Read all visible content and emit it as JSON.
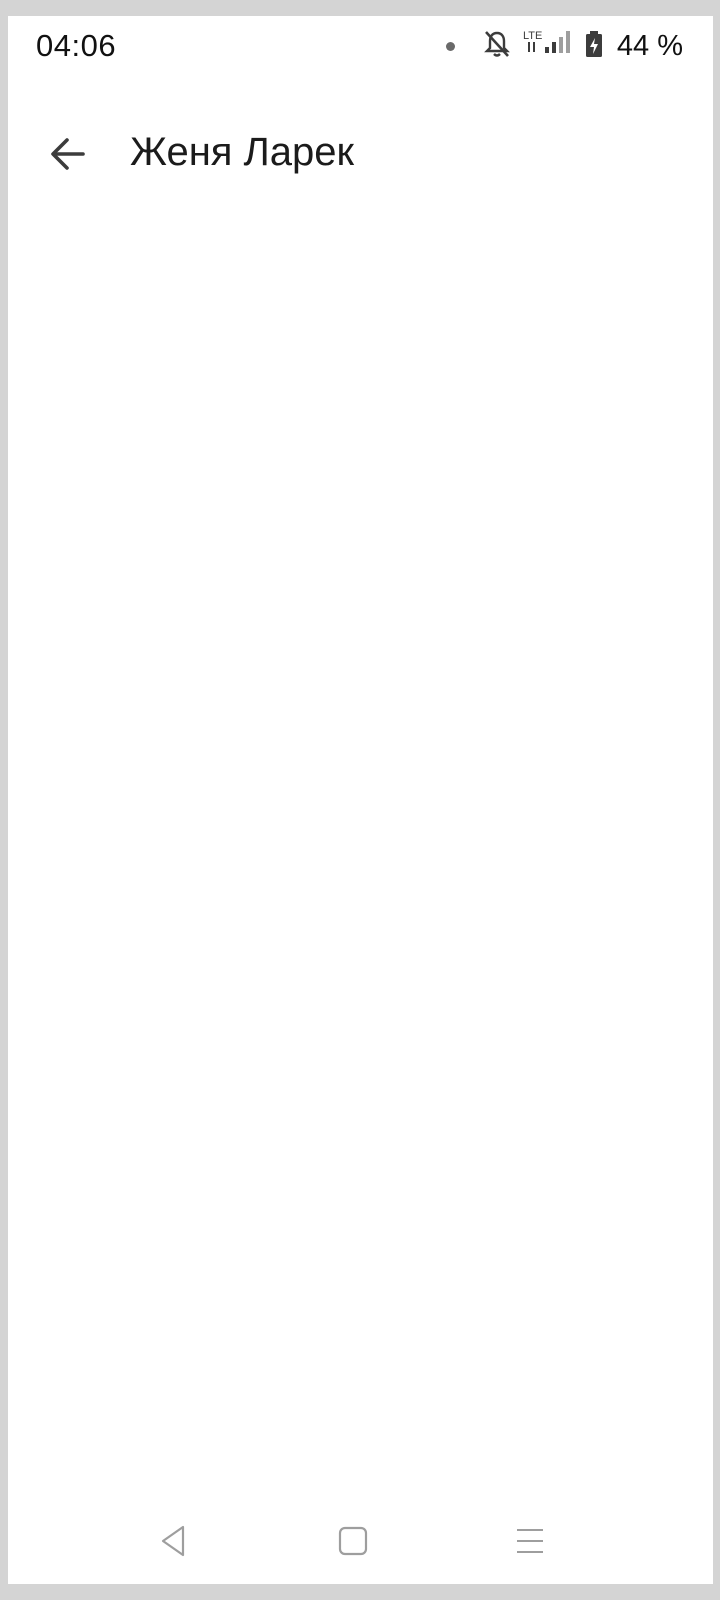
{
  "status_bar": {
    "time": "04:06",
    "battery_text": "44 %",
    "network_label": "LTE",
    "icons": [
      "notification-dot-icon",
      "bell-off-icon",
      "lte-signal-icon",
      "battery-charging-icon"
    ]
  },
  "app_bar": {
    "title": "Женя Ларек",
    "back_icon": "arrow-left-icon"
  },
  "nav_bar": {
    "icons": [
      "nav-back-icon",
      "nav-home-icon",
      "nav-menu-icon"
    ]
  },
  "colors": {
    "background": "#ffffff",
    "frame": "#d4d4d4",
    "text": "#1b1b1b",
    "icon": "#3c3c3c",
    "nav_icon": "#9e9e9e"
  }
}
